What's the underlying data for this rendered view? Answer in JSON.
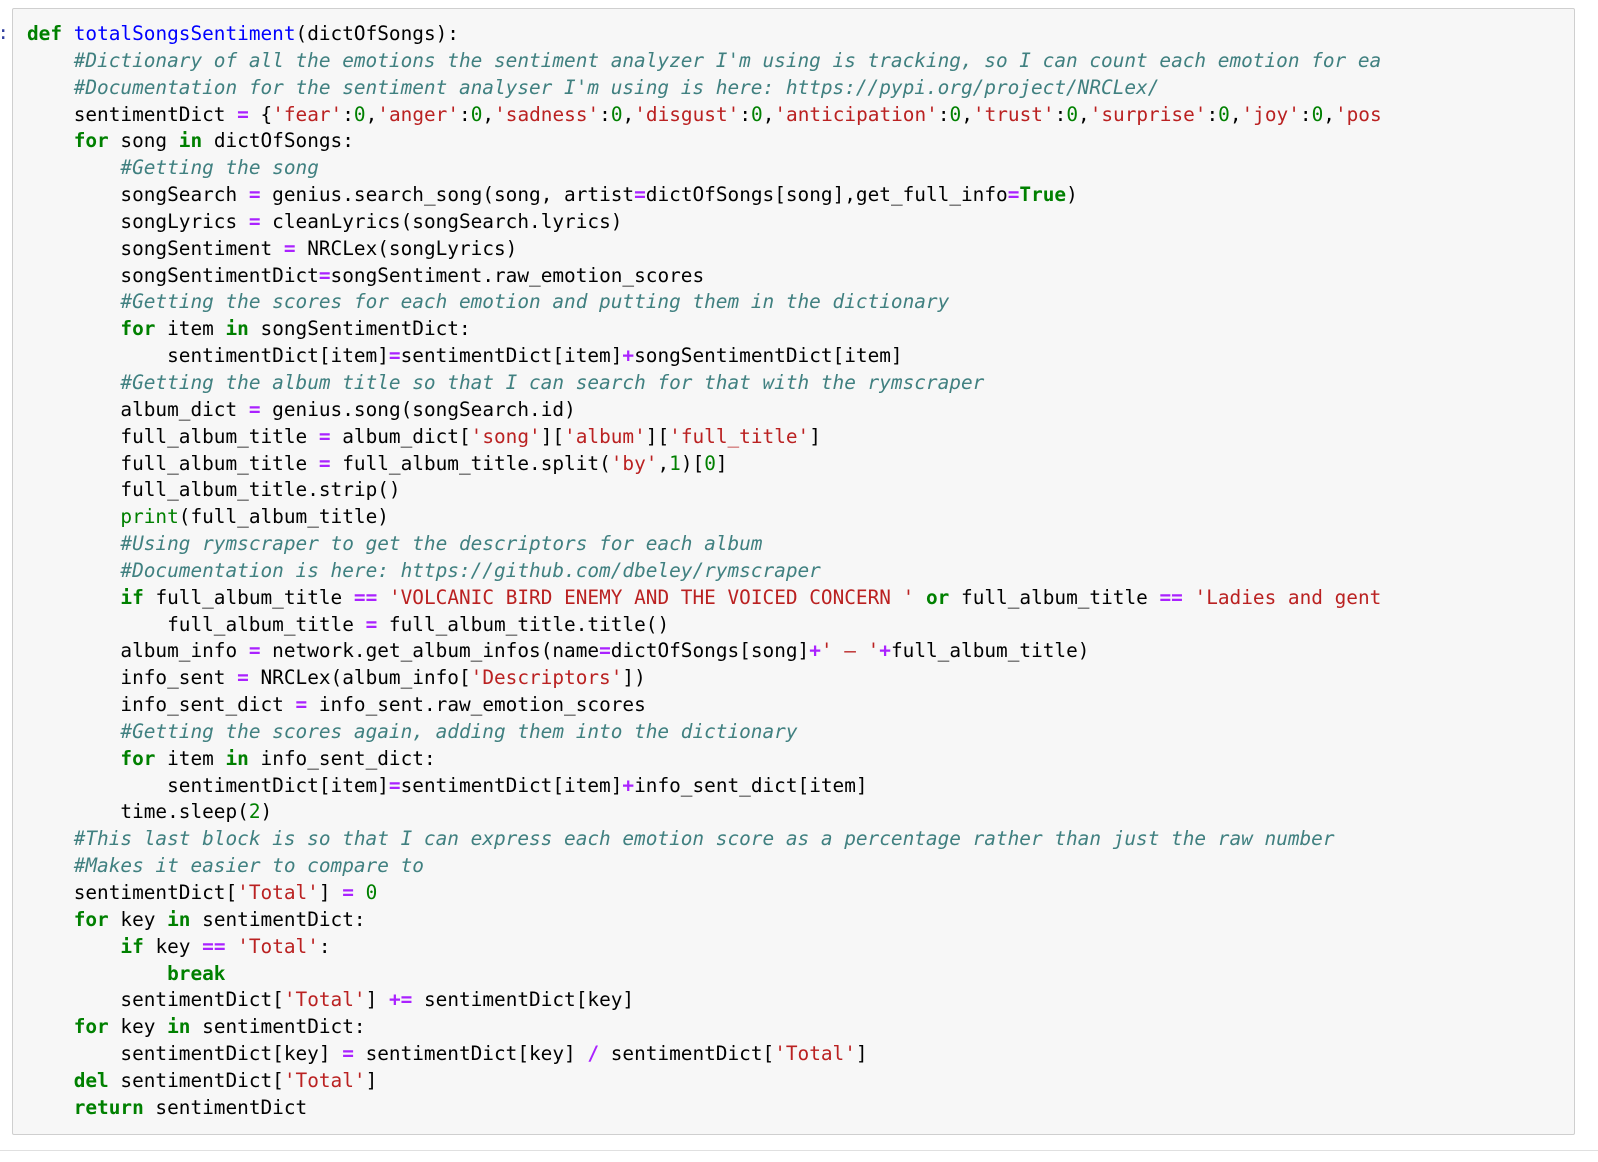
{
  "window": {
    "kind": "jupyter-notebook-code-cell",
    "prompt_glyph": "]:",
    "background_color": "#ffffff",
    "cell_background_color": "#f7f7f7",
    "cell_border_color": "#cfcfcf"
  },
  "theme": {
    "keyword_color": "#008000",
    "function_name_color": "#0000FF",
    "comment_color": "#408080",
    "string_color": "#BA2121",
    "number_color": "#008000",
    "operator_color": "#AA22FF",
    "text_color": "#000000"
  },
  "code": {
    "language": "python",
    "lines": [
      "def totalSongsSentiment(dictOfSongs):",
      "    #Dictionary of all the emotions the sentiment analyzer I'm using is tracking, so I can count each emotion for ea",
      "    #Documentation for the sentiment analyser I'm using is here: https://pypi.org/project/NRCLex/",
      "    sentimentDict = {'fear':0,'anger':0,'sadness':0,'disgust':0,'anticipation':0,'trust':0,'surprise':0,'joy':0,'pos",
      "    for song in dictOfSongs:",
      "        #Getting the song",
      "        songSearch = genius.search_song(song, artist=dictOfSongs[song],get_full_info=True)",
      "        songLyrics = cleanLyrics(songSearch.lyrics)",
      "        songSentiment = NRCLex(songLyrics)",
      "        songSentimentDict=songSentiment.raw_emotion_scores",
      "        #Getting the scores for each emotion and putting them in the dictionary",
      "        for item in songSentimentDict:",
      "            sentimentDict[item]=sentimentDict[item]+songSentimentDict[item]",
      "        #Getting the album title so that I can search for that with the rymscraper",
      "        album_dict = genius.song(songSearch.id)",
      "        full_album_title = album_dict['song']['album']['full_title']",
      "        full_album_title = full_album_title.split('by',1)[0]",
      "        full_album_title.strip()",
      "        print(full_album_title)",
      "        #Using rymscraper to get the descriptors for each album",
      "        #Documentation is here: https://github.com/dbeley/rymscraper",
      "        if full_album_title == 'VOLCANIC BIRD ENEMY AND THE VOICED CONCERN ' or full_album_title == 'Ladies and gent",
      "            full_album_title = full_album_title.title()",
      "        album_info = network.get_album_infos(name=dictOfSongs[song]+' – '+full_album_title)",
      "        info_sent = NRCLex(album_info['Descriptors'])",
      "        info_sent_dict = info_sent.raw_emotion_scores",
      "        #Getting the scores again, adding them into the dictionary",
      "        for item in info_sent_dict:",
      "            sentimentDict[item]=sentimentDict[item]+info_sent_dict[item]",
      "        time.sleep(2)",
      "    #This last block is so that I can express each emotion score as a percentage rather than just the raw number",
      "    #Makes it easier to compare to",
      "    sentimentDict['Total'] = 0",
      "    for key in sentimentDict:",
      "        if key == 'Total':",
      "            break",
      "        sentimentDict['Total'] += sentimentDict[key]",
      "    for key in sentimentDict:",
      "        sentimentDict[key] = sentimentDict[key] / sentimentDict['Total']",
      "    del sentimentDict['Total']",
      "    return sentimentDict"
    ],
    "highlighted_html": "<span class=\"k\">def</span> <span class=\"nf\">totalSongsSentiment</span>(dictOfSongs):\n    <span class=\"c\">#Dictionary of all the emotions the sentiment analyzer I'm using is tracking, so I can count each emotion for ea</span>\n    <span class=\"c\">#Documentation for the sentiment analyser I'm using is here: https://pypi.org/project/NRCLex/</span>\n    sentimentDict <span class=\"o\">=</span> {<span class=\"s\">'fear'</span>:<span class=\"mi\">0</span>,<span class=\"s\">'anger'</span>:<span class=\"mi\">0</span>,<span class=\"s\">'sadness'</span>:<span class=\"mi\">0</span>,<span class=\"s\">'disgust'</span>:<span class=\"mi\">0</span>,<span class=\"s\">'anticipation'</span>:<span class=\"mi\">0</span>,<span class=\"s\">'trust'</span>:<span class=\"mi\">0</span>,<span class=\"s\">'surprise'</span>:<span class=\"mi\">0</span>,<span class=\"s\">'joy'</span>:<span class=\"mi\">0</span>,<span class=\"s\">'pos</span>\n    <span class=\"k\">for</span> song <span class=\"k\">in</span> dictOfSongs:\n        <span class=\"c\">#Getting the song</span>\n        songSearch <span class=\"o\">=</span> genius<span class=\"n\">.</span>search_song(song, artist<span class=\"o\">=</span>dictOfSongs[song],get_full_info<span class=\"o\">=</span><span class=\"kc\">True</span>)\n        songLyrics <span class=\"o\">=</span> cleanLyrics(songSearch<span class=\"n\">.</span>lyrics)\n        songSentiment <span class=\"o\">=</span> NRCLex(songLyrics)\n        songSentimentDict<span class=\"o\">=</span>songSentiment<span class=\"n\">.</span>raw_emotion_scores\n        <span class=\"c\">#Getting the scores for each emotion and putting them in the dictionary</span>\n        <span class=\"k\">for</span> item <span class=\"k\">in</span> songSentimentDict:\n            sentimentDict[item]<span class=\"o\">=</span>sentimentDict[item]<span class=\"o\">+</span>songSentimentDict[item]\n        <span class=\"c\">#Getting the album title so that I can search for that with the rymscraper</span>\n        album_dict <span class=\"o\">=</span> genius<span class=\"n\">.</span>song(songSearch<span class=\"n\">.</span>id)\n        full_album_title <span class=\"o\">=</span> album_dict[<span class=\"s\">'song'</span>][<span class=\"s\">'album'</span>][<span class=\"s\">'full_title'</span>]\n        full_album_title <span class=\"o\">=</span> full_album_title<span class=\"n\">.</span>split(<span class=\"s\">'by'</span>,<span class=\"mi\">1</span>)[<span class=\"mi\">0</span>]\n        full_album_title<span class=\"n\">.</span>strip()\n        <span class=\"nf\" style=\"color:#008000\">print</span>(full_album_title)\n        <span class=\"c\">#Using rymscraper to get the descriptors for each album</span>\n        <span class=\"c\">#Documentation is here: https://github.com/dbeley/rymscraper</span>\n        <span class=\"k\">if</span> full_album_title <span class=\"o\">==</span> <span class=\"s\">'VOLCANIC BIRD ENEMY AND THE VOICED CONCERN '</span> <span class=\"k\">or</span> full_album_title <span class=\"o\">==</span> <span class=\"s\">'Ladies and gent</span>\n            full_album_title <span class=\"o\">=</span> full_album_title<span class=\"n\">.</span>title()\n        album_info <span class=\"o\">=</span> network<span class=\"n\">.</span>get_album_infos(name<span class=\"o\">=</span>dictOfSongs[song]<span class=\"o\">+</span><span class=\"s\">' – '</span><span class=\"o\">+</span>full_album_title)\n        info_sent <span class=\"o\">=</span> NRCLex(album_info[<span class=\"s\">'Descriptors'</span>])\n        info_sent_dict <span class=\"o\">=</span> info_sent<span class=\"n\">.</span>raw_emotion_scores\n        <span class=\"c\">#Getting the scores again, adding them into the dictionary</span>\n        <span class=\"k\">for</span> item <span class=\"k\">in</span> info_sent_dict:\n            sentimentDict[item]<span class=\"o\">=</span>sentimentDict[item]<span class=\"o\">+</span>info_sent_dict[item]\n        time<span class=\"n\">.</span>sleep(<span class=\"mi\">2</span>)\n    <span class=\"c\">#This last block is so that I can express each emotion score as a percentage rather than just the raw number</span>\n    <span class=\"c\">#Makes it easier to compare to</span>\n    sentimentDict[<span class=\"s\">'Total'</span>] <span class=\"o\">=</span> <span class=\"mi\">0</span>\n    <span class=\"k\">for</span> key <span class=\"k\">in</span> sentimentDict:\n        <span class=\"k\">if</span> key <span class=\"o\">==</span> <span class=\"s\">'Total'</span>:\n            <span class=\"k\">break</span>\n        sentimentDict[<span class=\"s\">'Total'</span>] <span class=\"o\">+=</span> sentimentDict[key]\n    <span class=\"k\">for</span> key <span class=\"k\">in</span> sentimentDict:\n        sentimentDict[key] <span class=\"o\">=</span> sentimentDict[key] <span class=\"o\">/</span> sentimentDict[<span class=\"s\">'Total'</span>]\n    <span class=\"k\">del</span> sentimentDict[<span class=\"s\">'Total'</span>]\n    <span class=\"k\">return</span> sentimentDict"
  }
}
